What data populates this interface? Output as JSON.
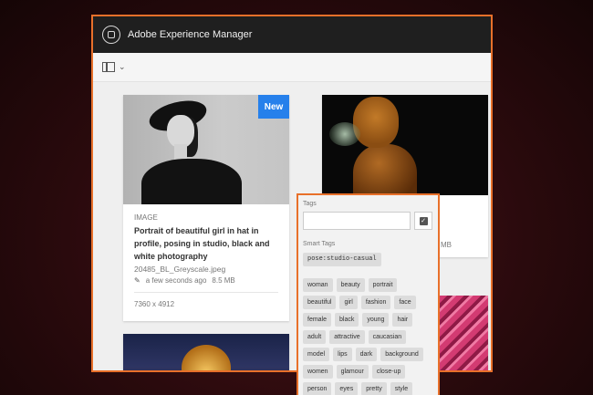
{
  "header": {
    "title": "Adobe Experience Manager"
  },
  "icons": {
    "logo": "aem-logo-icon",
    "rail": "rail-toggle-icon",
    "chevron": "chevron-down-icon",
    "edit": "pencil-icon",
    "check": "checkbox-icon"
  },
  "colors": {
    "highlight": "#e8702a",
    "badge": "#2680eb",
    "topbar": "#1f1f1f"
  },
  "cards": [
    {
      "badge": "New",
      "type": "IMAGE",
      "title": "Portrait of beautiful girl in hat in profile, posing in studio, black and white photography",
      "filename": "20485_BL_Greyscale.jpeg",
      "modified": "a few seconds ago",
      "size": "8.5 MB",
      "dimensions": "7360 x 4912"
    },
    {
      "size": "MB"
    }
  ],
  "tags_panel": {
    "tags_label": "Tags",
    "tags_input_value": "",
    "smart_tags_label": "Smart Tags",
    "smart_tags": [
      "pose:studio-casual",
      "woman",
      "beauty",
      "portrait",
      "beautiful",
      "girl",
      "fashion",
      "face",
      "female",
      "black",
      "young",
      "hair",
      "adult",
      "attractive",
      "caucasian",
      "model",
      "lips",
      "dark",
      "background",
      "women",
      "glamour",
      "close-up",
      "person",
      "eyes",
      "pretty",
      "style"
    ]
  }
}
